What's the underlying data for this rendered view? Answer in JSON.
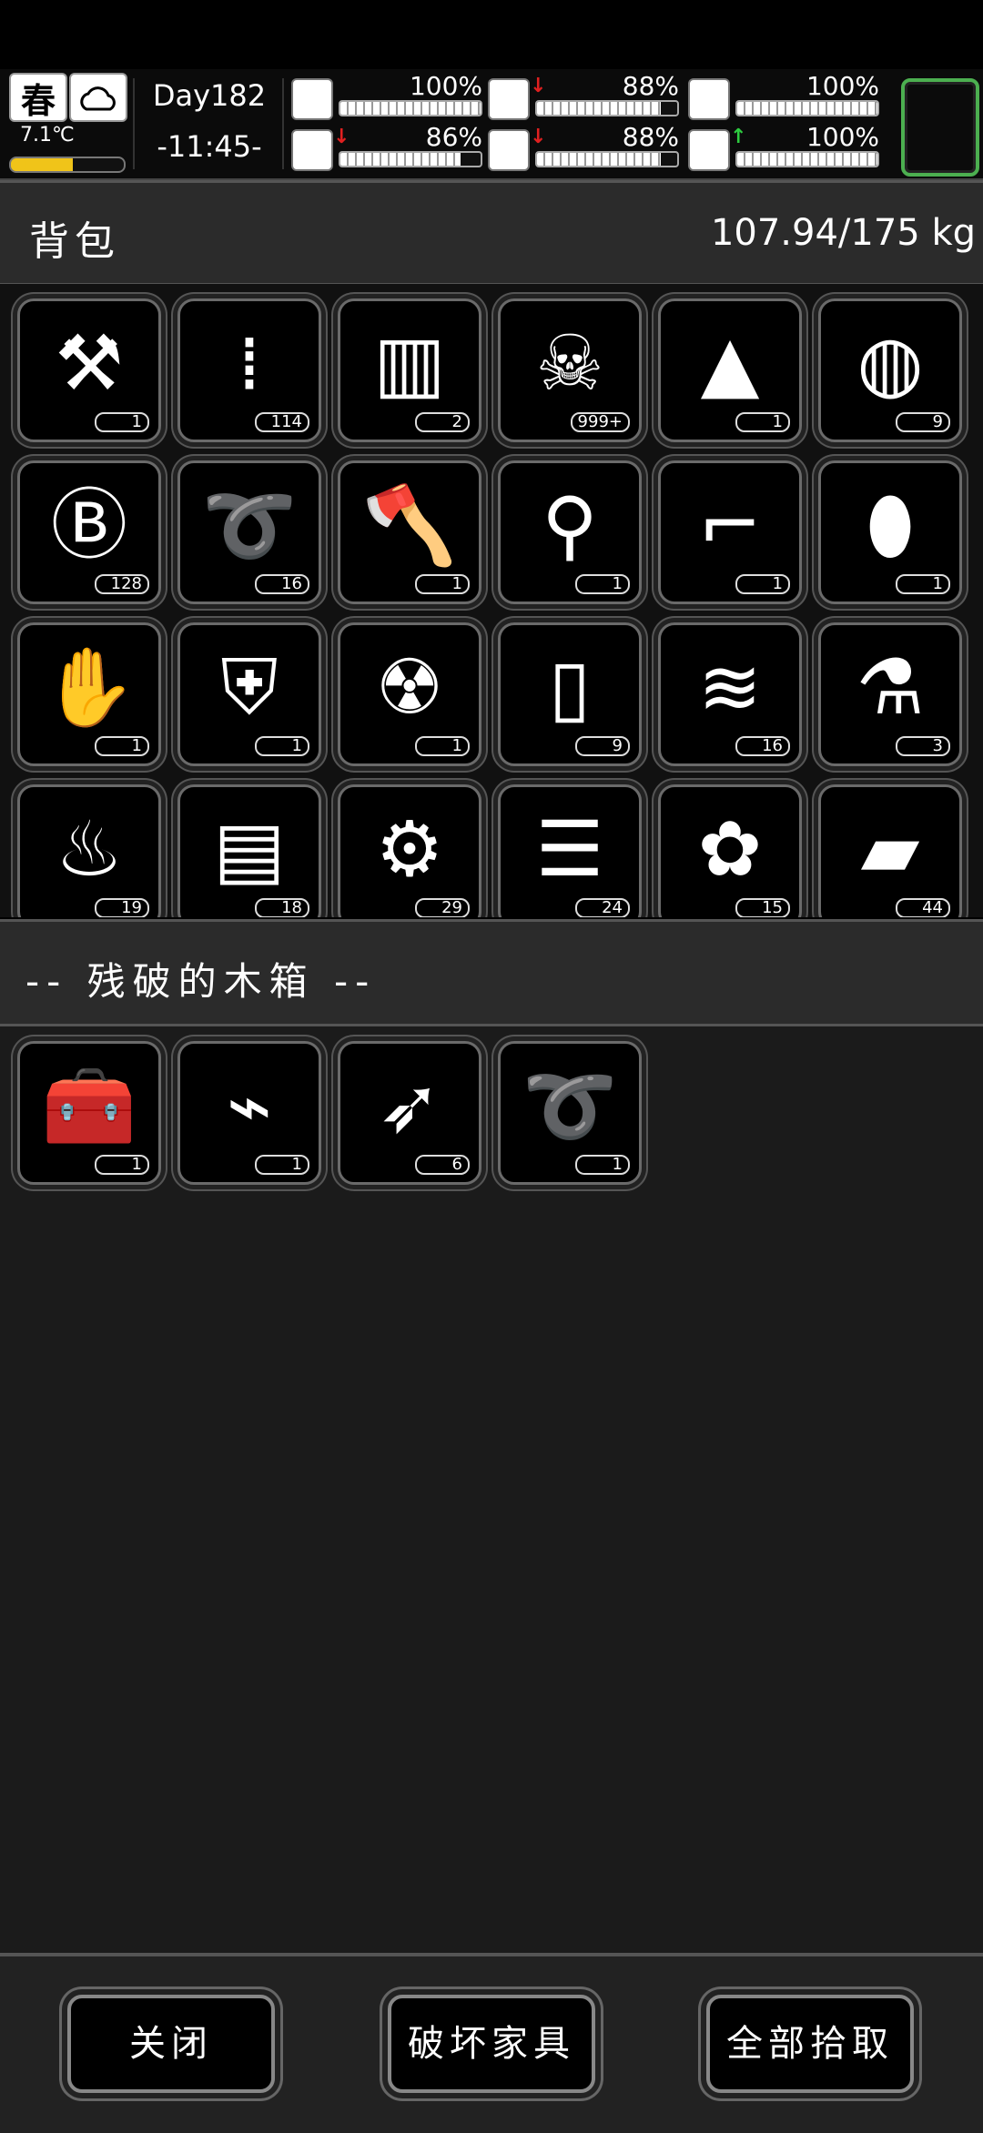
{
  "hud": {
    "season": "春",
    "weather_icon": "cloud-icon",
    "temperature": "7.1℃",
    "temperature_level": 0.55,
    "day": "Day182",
    "time": "-11:45-",
    "stats": [
      {
        "name": "health",
        "icon": "medkit-icon",
        "pct": "100%",
        "value": 1.0,
        "arrow": ""
      },
      {
        "name": "hunger",
        "icon": "stomach-icon",
        "pct": "88%",
        "value": 0.88,
        "arrow": "down"
      },
      {
        "name": "armor",
        "icon": "helmet-icon",
        "pct": "100%",
        "value": 1.0,
        "arrow": ""
      },
      {
        "name": "stamina",
        "icon": "leg-icon",
        "pct": "86%",
        "value": 0.86,
        "arrow": "down"
      },
      {
        "name": "thirst",
        "icon": "water-drop-icon",
        "pct": "88%",
        "value": 0.88,
        "arrow": "down"
      },
      {
        "name": "mood",
        "icon": "heart-icon",
        "pct": "100%",
        "value": 1.0,
        "arrow": "up"
      }
    ]
  },
  "bag": {
    "title": "背包",
    "weight": "107.94/175 kg",
    "items": [
      {
        "name": "workbench-icon",
        "glyph": "⚒",
        "count": "1"
      },
      {
        "name": "bullets-icon",
        "glyph": "⁞",
        "count": "114"
      },
      {
        "name": "towel-icon",
        "glyph": "▥",
        "count": "2"
      },
      {
        "name": "zombie-poster-icon",
        "glyph": "☠",
        "count": "999+"
      },
      {
        "name": "cloth-rag-icon",
        "glyph": "▲",
        "count": "1"
      },
      {
        "name": "net-icon",
        "glyph": "◍",
        "count": "9"
      },
      {
        "name": "coin-icon",
        "glyph": "Ⓑ",
        "count": "128"
      },
      {
        "name": "rope-icon",
        "glyph": "➰",
        "count": "16"
      },
      {
        "name": "axe-icon",
        "glyph": "🪓",
        "count": "1"
      },
      {
        "name": "shovel-icon",
        "glyph": "⚲",
        "count": "1"
      },
      {
        "name": "pistol-icon",
        "glyph": "⌐",
        "count": "1"
      },
      {
        "name": "riot-shield-icon",
        "glyph": "⬮",
        "count": "1"
      },
      {
        "name": "gloves-icon",
        "glyph": "✋",
        "count": "1"
      },
      {
        "name": "body-armor-icon",
        "glyph": "⛨",
        "count": "1"
      },
      {
        "name": "gas-mask-icon",
        "glyph": "☢",
        "count": "1"
      },
      {
        "name": "cloth-sheet-icon",
        "glyph": "▯",
        "count": "9"
      },
      {
        "name": "folded-cloth-icon",
        "glyph": "≋",
        "count": "16"
      },
      {
        "name": "test-tube-icon",
        "glyph": "⚗",
        "count": "3"
      },
      {
        "name": "spray-bottle-icon",
        "glyph": "♨",
        "count": "19"
      },
      {
        "name": "planks-icon",
        "glyph": "▤",
        "count": "18"
      },
      {
        "name": "scrap-metal-icon",
        "glyph": "⚙",
        "count": "29"
      },
      {
        "name": "logs-icon",
        "glyph": "☰",
        "count": "24"
      },
      {
        "name": "cotton-icon",
        "glyph": "✿",
        "count": "15"
      },
      {
        "name": "brick-icon",
        "glyph": "▰",
        "count": "44"
      }
    ]
  },
  "container": {
    "title": "-- 残破的木箱 --",
    "items": [
      {
        "name": "toolbox-icon",
        "glyph": "🧰",
        "count": "1"
      },
      {
        "name": "sniper-rifle-icon",
        "glyph": "⌁",
        "count": "1"
      },
      {
        "name": "rocket-ammo-icon",
        "glyph": "➶",
        "count": "6"
      },
      {
        "name": "rope-icon",
        "glyph": "➰",
        "count": "1"
      }
    ]
  },
  "buttons": {
    "close": "关闭",
    "destroy": "破坏家具",
    "take_all": "全部拾取"
  },
  "colors": {
    "up_arrow": "#2ecc40",
    "down_arrow": "#e02020",
    "empty_slot_border": "#4caf50"
  }
}
